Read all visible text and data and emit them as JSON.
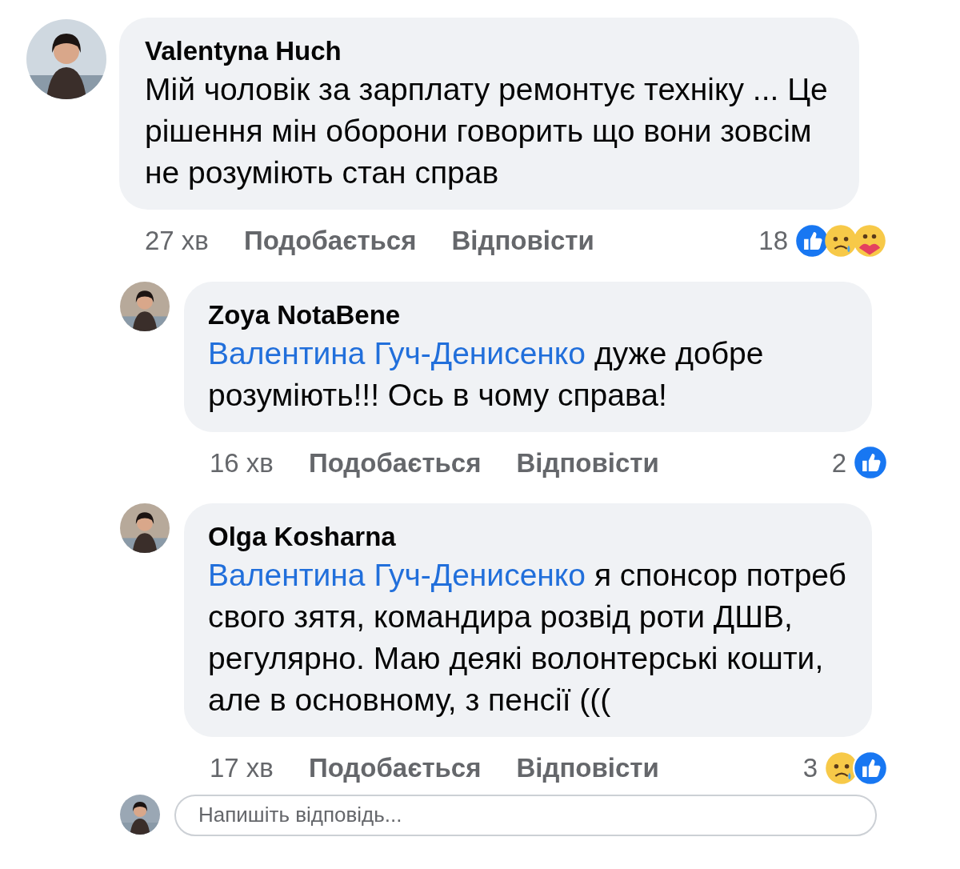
{
  "comments": [
    {
      "author": "Valentyna Huch",
      "kind": "top",
      "text": "Мій чоловік за зарплату ремонтує техніку ... Це рішення мін оборони говорить що вони зовсім не розуміють стан справ",
      "time": "27 хв",
      "actions": [
        "Подобається",
        "Відповісти"
      ],
      "reaction_count": "18",
      "reactions": [
        {
          "kind": "like"
        },
        {
          "kind": "sad"
        },
        {
          "kind": "care"
        }
      ]
    },
    {
      "author": "Zoya NotaBene",
      "kind": "reply",
      "mention": "Валентина Гуч-Денисенко",
      "text": "дуже добре розуміють!!! Ось в чому справа!",
      "time": "16 хв",
      "actions": [
        "Подобається",
        "Відповісти"
      ],
      "reaction_count": "2",
      "reactions": [
        {
          "kind": "like"
        }
      ]
    },
    {
      "author": "Olga Kosharna",
      "kind": "reply",
      "mention": "Валентина Гуч-Денисенко",
      "text": "я спонсор потреб  свого зятя, командира розвід роти ДШВ, регулярно. Маю деякі волонтерські кошти, але в основному, з пенсії (((",
      "time": "17 хв",
      "actions": [
        "Подобається",
        "Відповісти"
      ],
      "reaction_count": "3",
      "reactions": [
        {
          "kind": "sad"
        },
        {
          "kind": "like"
        }
      ]
    }
  ],
  "reply_field": {
    "placeholder": "Напишіть відповідь..."
  }
}
